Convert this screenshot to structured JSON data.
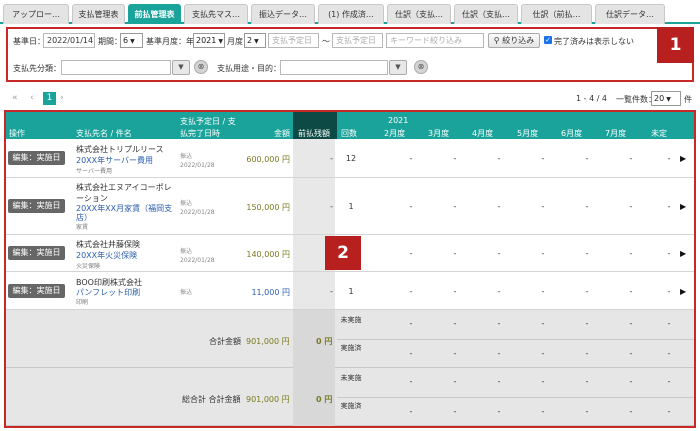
{
  "tabs": [
    "アップロー…",
    "支払管理表",
    "前払管理表",
    "支払先マス…",
    "振込データ…",
    "(1) 作成済…",
    "仕訳（支払…",
    "仕訳（支払…",
    "仕訳（前払…",
    "仕訳データ…"
  ],
  "filter": {
    "base_date_label": "基準日：",
    "base_date": "2022/01/14",
    "period_label": "期間：",
    "period": "6",
    "month_label": "基準月度：年",
    "year": "2021",
    "month_unit": "月度",
    "month": "2",
    "due_from_ph": "支払予定日",
    "tilde": "〜",
    "due_to_ph": "支払予定日",
    "keyword_ph": "キーワード絞り込み",
    "filter_btn": "絞り込み",
    "hide_done": "完了済みは表示しない",
    "cat_label": "支払先分類：",
    "purpose_label": "支払用途・目的：",
    "badge": "1"
  },
  "pager": {
    "first": "«",
    "prev": "‹",
    "page": "1",
    "next": "›",
    "range": "1 - 4 / 4",
    "per_page_label": "一覧件数：",
    "per_page": "20",
    "unit": "件"
  },
  "table": {
    "headers": {
      "op": "操作",
      "name": "支払先名 / 件名",
      "due1": "支払予定日 / 支",
      "due2": "払完了日時",
      "amount": "金額",
      "prepaid": "前払残額",
      "count": "回数",
      "year": "2021",
      "months": [
        "2月度",
        "3月度",
        "4月度",
        "5月度",
        "6月度",
        "7月度",
        "未定"
      ]
    },
    "edit_label": "編集：実施日",
    "rows": [
      {
        "vendor": "株式会社トリプルリース",
        "subject": "20XX年サーバー費用",
        "purpose": "サーバー費用",
        "method": "振込",
        "date": "2022/01/28",
        "amount": "600,000 円",
        "prepaid": "-",
        "count": "12"
      },
      {
        "vendor1": "株式会社エヌアイコーポレ",
        "vendor2": "ーション",
        "subject1": "20XX年XX月家賃（福岡支",
        "subject2": "店）",
        "purpose": "家賃",
        "method": "振込",
        "date": "2022/01/28",
        "amount": "150,000 円",
        "prepaid": "-",
        "count": "1"
      },
      {
        "vendor": "株式会社井藤保険",
        "subject": "20XX年火災保険",
        "purpose": "火災保険",
        "method": "振込",
        "date": "2022/01/28",
        "amount": "140,000 円",
        "prepaid": "-",
        "count": "1"
      },
      {
        "vendor": "BOO印刷株式会社",
        "subject": "パンフレット印刷",
        "purpose": "印刷",
        "method": "振込",
        "amount": "11,000 円",
        "prepaid": "-",
        "count": "1"
      }
    ],
    "dash": "-",
    "total_label": "合計金額",
    "total_amount": "901,000 円",
    "total_prepaid": "0 円",
    "grand_label": "総合計 合計金額",
    "grand_amount": "901,000 円",
    "grand_prepaid": "0 円",
    "not_done": "未実施",
    "done": "実施済",
    "badge": "2"
  },
  "colors": {
    "teal": "#1aa39a",
    "red": "#c82828",
    "badge": "#b81f1f",
    "link": "#2a5db0"
  }
}
